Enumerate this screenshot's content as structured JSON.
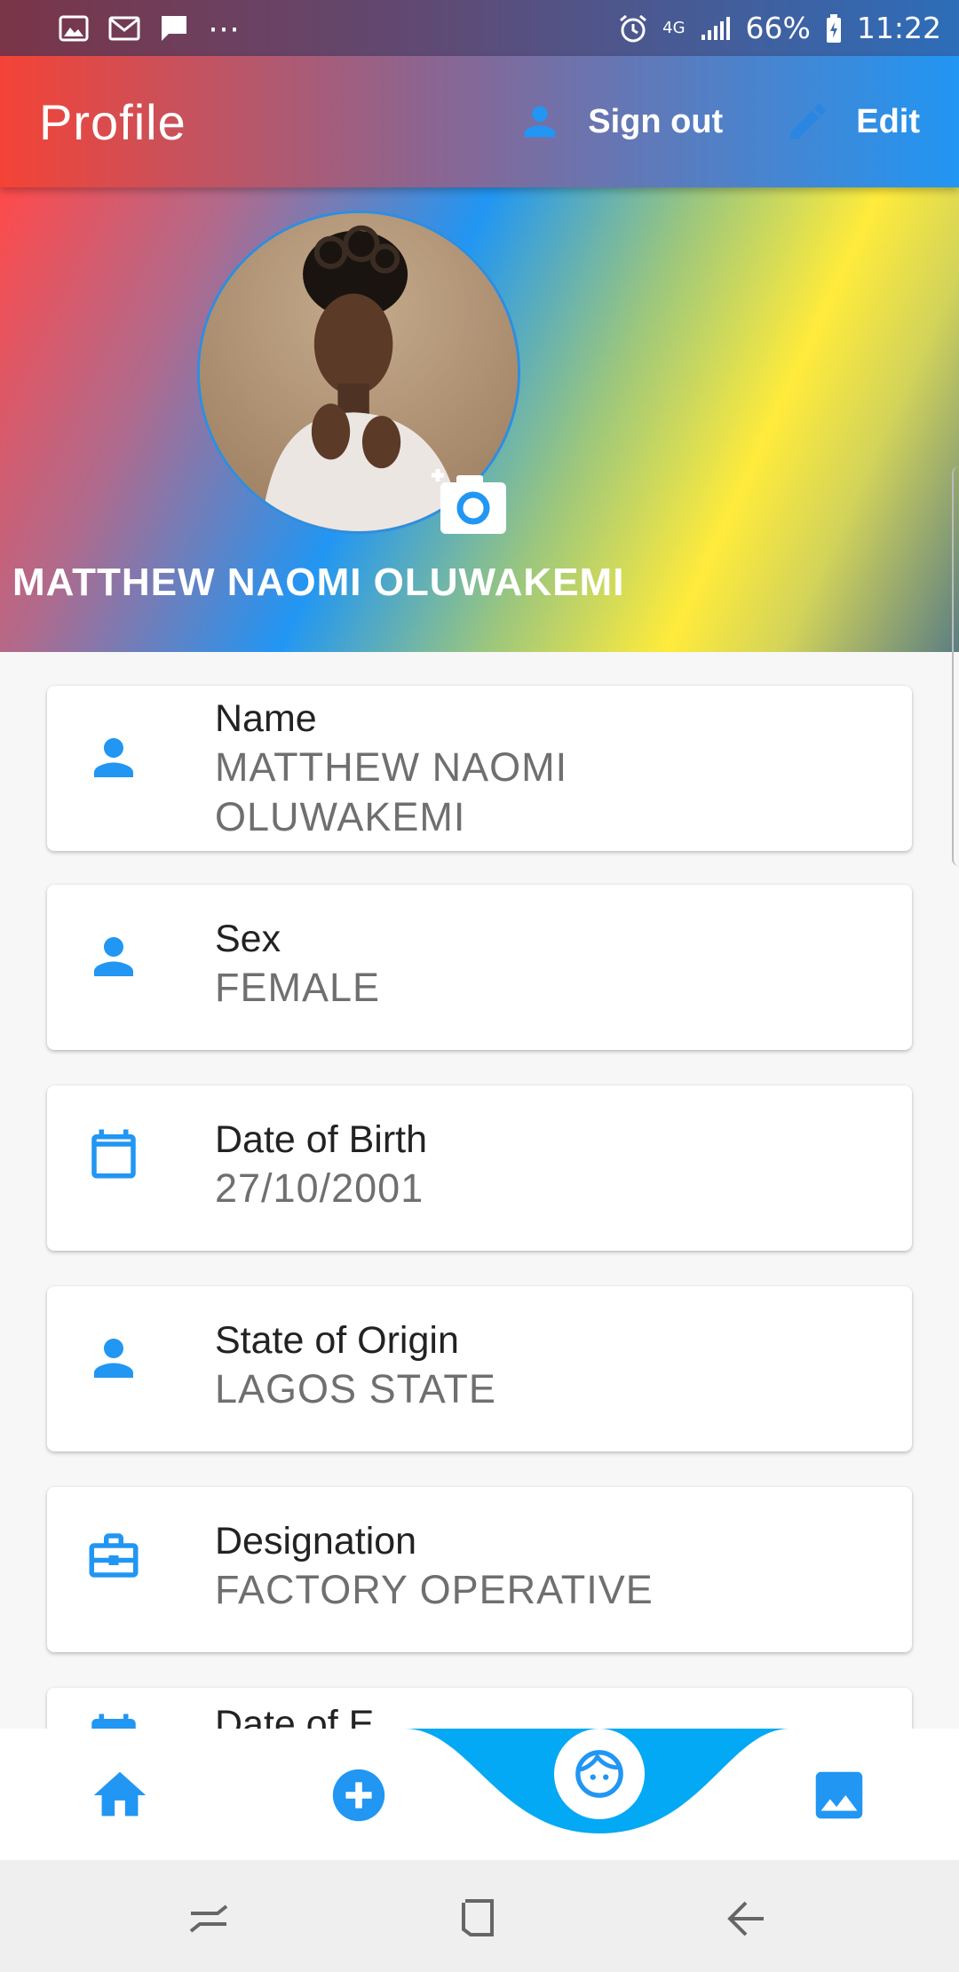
{
  "status_bar": {
    "left_icons": [
      "gallery-icon",
      "gmail-icon",
      "message-icon",
      "more-dots-icon"
    ],
    "more_dots": "⋯",
    "network": "4G",
    "battery": "66%",
    "time": "11:22"
  },
  "app_bar": {
    "title": "Profile",
    "sign_out_label": "Sign out",
    "edit_label": "Edit"
  },
  "profile": {
    "name": "MATTHEW NAOMI OLUWAKEMI"
  },
  "cards": [
    {
      "icon": "person-icon",
      "label": "Name",
      "value_line1": "MATTHEW NAOMI",
      "value_line2": "OLUWAKEMI"
    },
    {
      "icon": "person-icon",
      "label": "Sex",
      "value": "FEMALE"
    },
    {
      "icon": "calendar-icon",
      "label": "Date of Birth",
      "value": "27/10/2001"
    },
    {
      "icon": "person-icon",
      "label": "State of Origin",
      "value": "LAGOS STATE"
    },
    {
      "icon": "briefcase-icon",
      "label": "Designation",
      "value": "FACTORY OPERATIVE"
    },
    {
      "icon": "calendar-icon",
      "label": "Date of E",
      "value": ""
    }
  ],
  "bottom_nav": {
    "items": [
      "home-icon",
      "add-circle-icon",
      "face-icon",
      "image-icon"
    ],
    "active": "face-icon"
  },
  "colors": {
    "accent": "#2196f3",
    "wave": "#03a9f4",
    "card_bg": "#ffffff",
    "page_bg": "#f7f7f7"
  }
}
